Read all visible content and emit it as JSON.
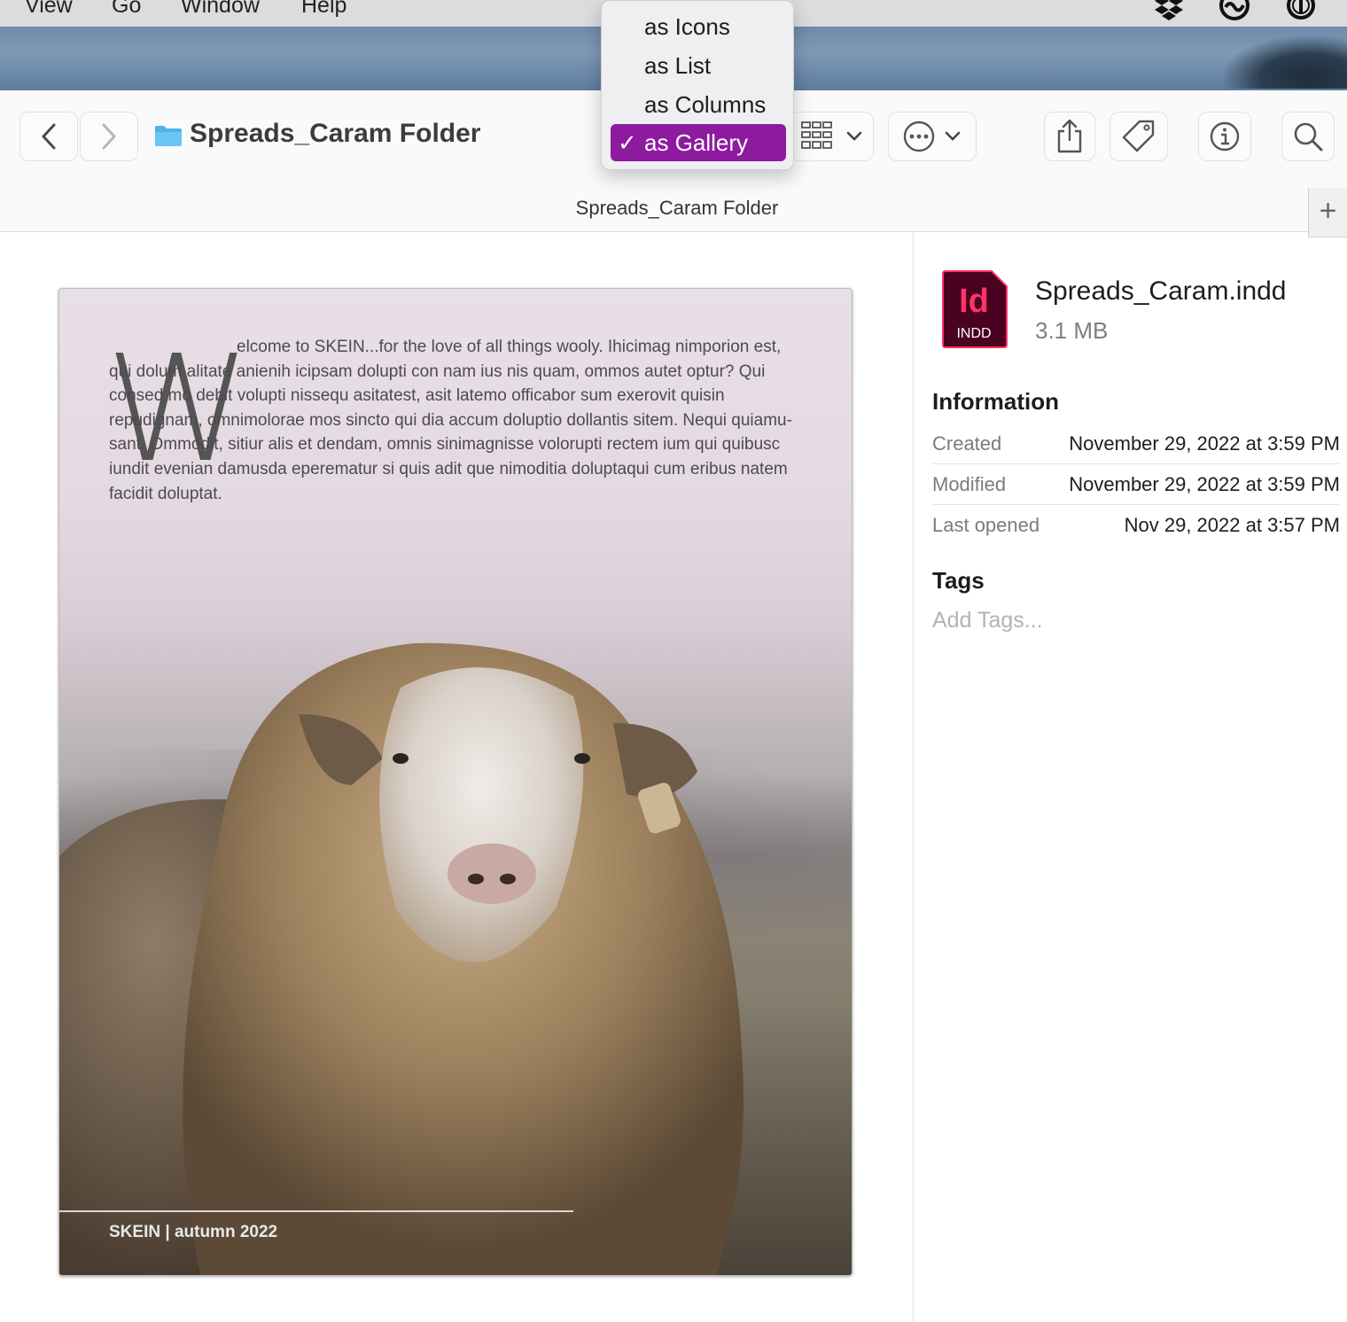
{
  "menubar": {
    "items": [
      "View",
      "Go",
      "Window",
      "Help"
    ],
    "status_icons": [
      "dropbox-icon",
      "creative-cloud-icon",
      "onepassword-icon"
    ]
  },
  "toolbar": {
    "back_icon": "chevron-left-icon",
    "forward_icon": "chevron-right-icon",
    "folder_title": "Spreads_Caram Folder",
    "view_icon": "gallery-grid-icon",
    "more_icon": "ellipsis-circle-icon",
    "share_icon": "share-icon",
    "tag_icon": "tag-icon",
    "info_icon": "info-icon",
    "search_icon": "search-icon"
  },
  "view_menu": {
    "items": [
      {
        "label": "as Icons",
        "selected": false
      },
      {
        "label": "as List",
        "selected": false
      },
      {
        "label": "as Columns",
        "selected": false
      },
      {
        "label": "as Gallery",
        "selected": true
      }
    ],
    "check": "✓",
    "accent_color": "#8e1aa0"
  },
  "pathbar": {
    "title": "Spreads_Caram Folder",
    "add_tab": "+"
  },
  "preview": {
    "drop_cap": "W",
    "article": "elcome to SKEIN...for the love of all things wooly. Ihicimag nimporion est, qui dolum alitate anienih icipsam dolupti con nam ius nis quam, ommos autet optur? Qui consed mo debit volupti nissequ asitatest, asit latemo officabor sum exerovit quisin repudignam, omnimolorae mos sincto qui dia accum doluptio dollantis sitem. Nequi quiamu-sant. Ommodit, sitiur alis et dendam, omnis sinimagnisse volorupti rectem ium qui quibusc iundit evenian damusda eperematur si quis adit que nimoditia doluptaqui cum eribus natem facidit doluptat.",
    "footer": "SKEIN | autumn 2022"
  },
  "info": {
    "file_badge": "Id",
    "file_type": "INDD",
    "file_name": "Spreads_Caram.indd",
    "file_size": "3.1 MB",
    "information_heading": "Information",
    "rows": [
      {
        "label": "Created",
        "value": "November 29, 2022 at 3:59 PM"
      },
      {
        "label": "Modified",
        "value": "November 29, 2022 at 3:59 PM"
      },
      {
        "label": "Last opened",
        "value": "Nov 29, 2022 at 3:57 PM"
      }
    ],
    "tags_heading": "Tags",
    "tags_placeholder": "Add Tags..."
  }
}
